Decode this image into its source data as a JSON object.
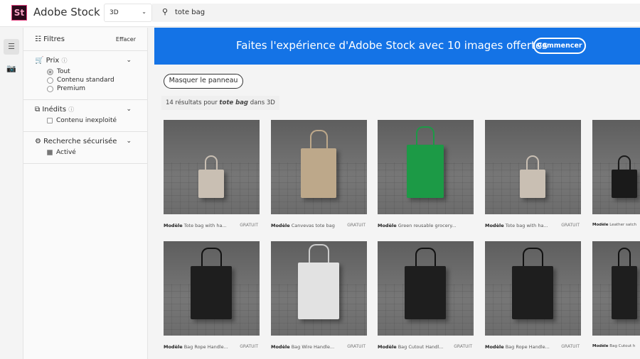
{
  "header": {
    "logo": "St",
    "brand": "Adobe Stock",
    "category": "3D",
    "search_value": "tote bag"
  },
  "filters": {
    "title": "Filtres",
    "clear": "Effacer",
    "price": {
      "label": "Prix",
      "options": [
        {
          "label": "Tout",
          "selected": true
        },
        {
          "label": "Contenu standard",
          "selected": false
        },
        {
          "label": "Premium",
          "selected": false
        }
      ]
    },
    "unused": {
      "label": "Inédits",
      "option": "Contenu inexploité",
      "checked": false
    },
    "safe": {
      "label": "Recherche sécurisée",
      "option": "Activé",
      "checked": true
    }
  },
  "banner": {
    "text": "Faites l'expérience d'Adobe Stock avec 10 images offertes",
    "button": "Commencer"
  },
  "hide_panel": "Masquer le panneau",
  "results": {
    "count": "14 résultats pour ",
    "query": "tote bag",
    "suffix": " dans 3D"
  },
  "items": [
    {
      "type": "Modèle",
      "title": "Tote bag with ha...",
      "badge": "GRATUIT",
      "color": "#c9bfb3"
    },
    {
      "type": "Modèle",
      "title": "Canvevas tote bag",
      "badge": "GRATUIT",
      "color": "#bda88a"
    },
    {
      "type": "Modèle",
      "title": "Green reusable grocery...",
      "badge": "",
      "color": "#1c9a46"
    },
    {
      "type": "Modèle",
      "title": "Tote bag with ha...",
      "badge": "GRATUIT",
      "color": "#c9bfb3"
    },
    {
      "type": "Modèle",
      "title": "Leather satch",
      "badge": "",
      "color": "#1a1a1a"
    },
    {
      "type": "Modèle",
      "title": "Bag Rope Handle...",
      "badge": "GRATUIT",
      "color": "#1e1e1e"
    },
    {
      "type": "Modèle",
      "title": "Bag Wire Handle...",
      "badge": "GRATUIT",
      "color": "#e2e2e2"
    },
    {
      "type": "Modèle",
      "title": "Bag Cutout Handl...",
      "badge": "GRATUIT",
      "color": "#1e1e1e"
    },
    {
      "type": "Modèle",
      "title": "Bag Rope Handle...",
      "badge": "GRATUIT",
      "color": "#1e1e1e"
    },
    {
      "type": "Modèle",
      "title": "Bag Cutout h",
      "badge": "",
      "color": "#1e1e1e"
    }
  ]
}
